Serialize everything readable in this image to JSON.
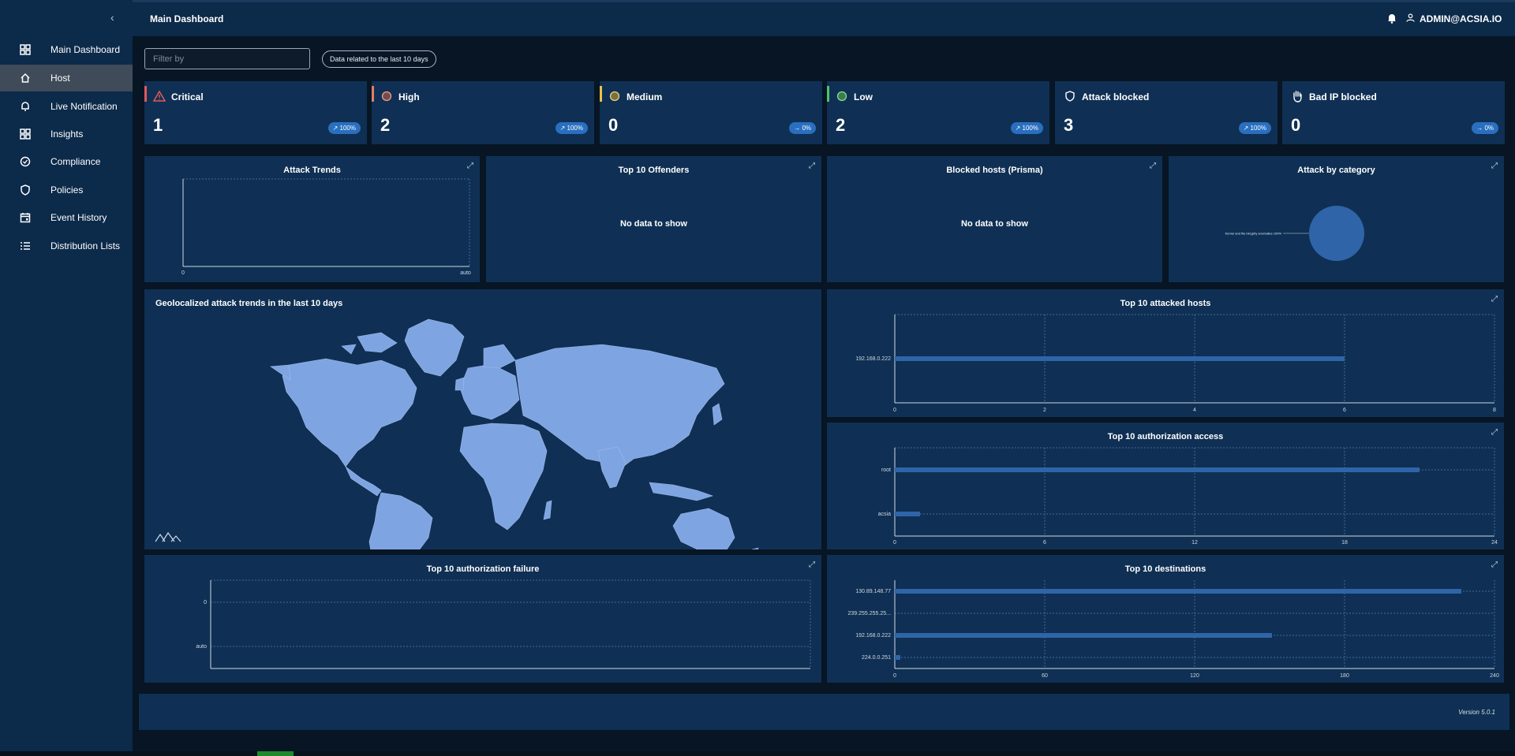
{
  "sidebar": {
    "items": [
      {
        "label": "Main Dashboard",
        "icon": "dashboard-icon"
      },
      {
        "label": "Host",
        "icon": "home-icon"
      },
      {
        "label": "Live Notification",
        "icon": "bell-icon"
      },
      {
        "label": "Insights",
        "icon": "grid-icon"
      },
      {
        "label": "Compliance",
        "icon": "compliance-icon"
      },
      {
        "label": "Policies",
        "icon": "shield-icon"
      },
      {
        "label": "Event History",
        "icon": "calendar-icon"
      },
      {
        "label": "Distribution Lists",
        "icon": "list-icon"
      }
    ],
    "active_index": 1,
    "collapse_glyph": "‹"
  },
  "header": {
    "title": "Main Dashboard",
    "user": "ADMIN@ACSIA.IO"
  },
  "filter": {
    "placeholder": "Filter by",
    "range_label": "Data related to the last 10 days"
  },
  "cards": [
    {
      "label": "Critical",
      "value": "1",
      "badge": "100%",
      "trend": "up",
      "color": "#e05a5a",
      "icon": "warning-icon"
    },
    {
      "label": "High",
      "value": "2",
      "badge": "100%",
      "trend": "up",
      "color": "#e0806a",
      "icon": "circle-icon"
    },
    {
      "label": "Medium",
      "value": "0",
      "badge": "0%",
      "trend": "flat",
      "color": "#e8c34a",
      "icon": "circle-icon"
    },
    {
      "label": "Low",
      "value": "2",
      "badge": "100%",
      "trend": "up",
      "color": "#4ec46a",
      "icon": "circle-icon"
    },
    {
      "label": "Attack blocked",
      "value": "3",
      "badge": "100%",
      "trend": "up",
      "color": "",
      "icon": "shield-icon"
    },
    {
      "label": "Bad IP blocked",
      "value": "0",
      "badge": "0%",
      "trend": "flat",
      "color": "",
      "icon": "hand-icon"
    }
  ],
  "panels": {
    "attack_trends": {
      "title": "Attack Trends"
    },
    "top_offenders": {
      "title": "Top 10 Offenders",
      "empty": "No data to show"
    },
    "blocked_hosts": {
      "title": "Blocked hosts (Prisma)",
      "empty": "No data to show"
    },
    "attack_category": {
      "title": "Attack by category"
    },
    "geo": {
      "title": "Geolocalized attack trends in the last 10 days"
    },
    "attacked_hosts": {
      "title": "Top 10 attacked hosts"
    },
    "auth_access": {
      "title": "Top 10 authorization access"
    },
    "auth_failure": {
      "title": "Top 10 authorization failure"
    },
    "destinations": {
      "title": "Top 10 destinations"
    }
  },
  "footer": {
    "version": "Version 5.0.1"
  },
  "chart_data": [
    {
      "id": "attack_trends",
      "type": "line",
      "title": "Attack Trends",
      "x": [],
      "series": [],
      "tick_labels_x": [
        "0",
        "auto"
      ],
      "grid": true
    },
    {
      "id": "attack_category",
      "type": "pie",
      "title": "Attack by category",
      "slices": [
        {
          "label": "Kernel and file integrity anomalies 100%",
          "value": 100
        }
      ],
      "color": "#2f64a8"
    },
    {
      "id": "attacked_hosts",
      "type": "bar",
      "orientation": "horizontal",
      "title": "Top 10 attacked hosts",
      "categories": [
        "192.168.0.222"
      ],
      "values": [
        6
      ],
      "xlim": [
        0,
        8
      ],
      "xticks": [
        0,
        2,
        4,
        6,
        8
      ],
      "grid": true
    },
    {
      "id": "auth_access",
      "type": "bar",
      "orientation": "horizontal",
      "title": "Top 10 authorization access",
      "categories": [
        "root",
        "acsia"
      ],
      "values": [
        21,
        1
      ],
      "xlim": [
        0,
        24
      ],
      "xticks": [
        0,
        6,
        12,
        18,
        24
      ],
      "grid": true
    },
    {
      "id": "auth_failure",
      "type": "bar",
      "orientation": "horizontal",
      "title": "Top 10 authorization failure",
      "categories": [
        "0",
        "auto"
      ],
      "values": [],
      "grid": true
    },
    {
      "id": "destinations",
      "type": "bar",
      "orientation": "horizontal",
      "title": "Top 10 destinations",
      "categories": [
        "130.89.148.77",
        "239.255.255.25...",
        "192.168.0.222",
        "224.0.0.251"
      ],
      "values": [
        225,
        0,
        150,
        2
      ],
      "xlim": [
        0,
        240
      ],
      "xticks": [
        0,
        60,
        120,
        180,
        240
      ],
      "grid": true
    }
  ]
}
